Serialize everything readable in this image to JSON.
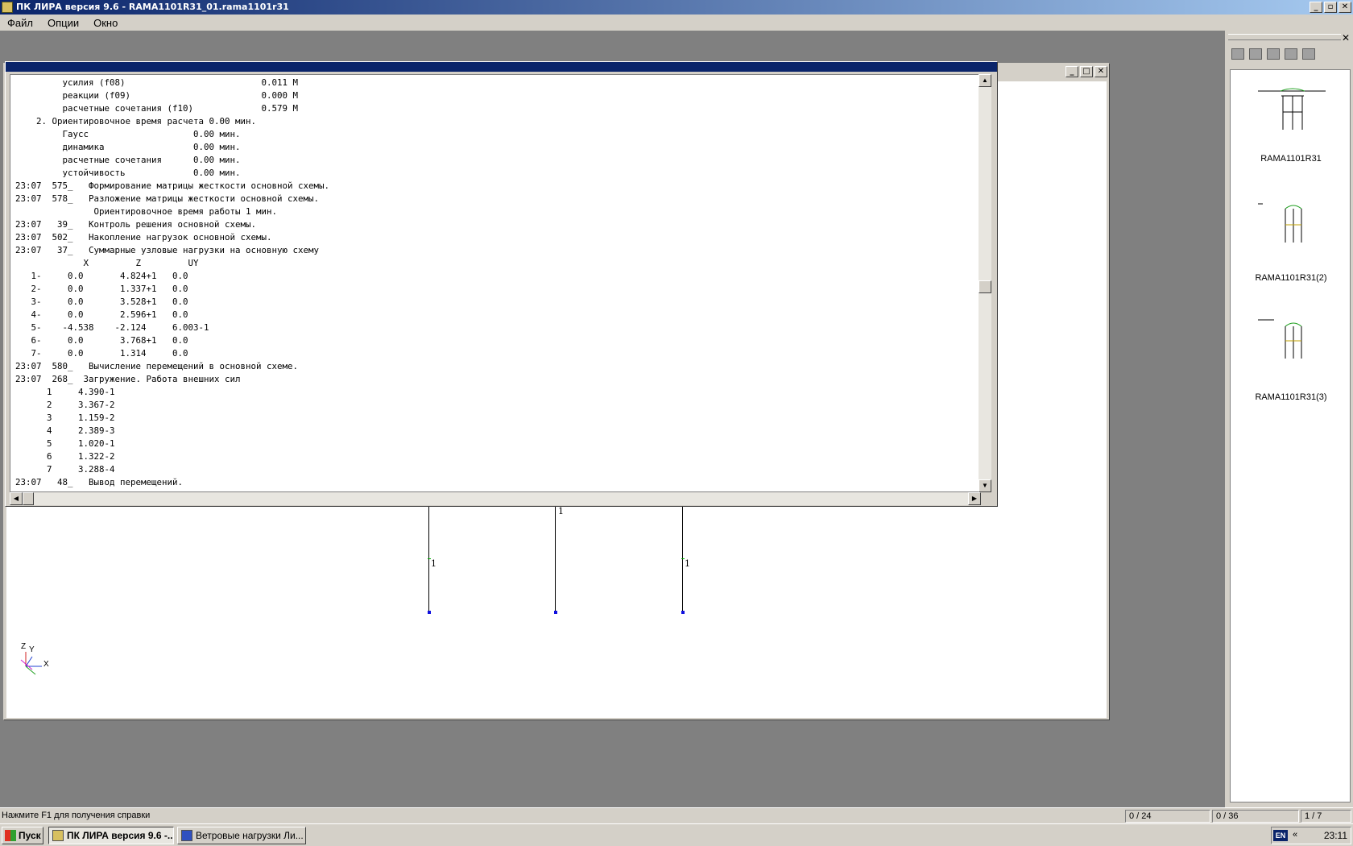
{
  "app": {
    "title": "ПК ЛИРА  версия 9.6 - RAMA1101R31_01.rama1101r31",
    "caption_buttons": [
      "_",
      "▫",
      "✕"
    ]
  },
  "menu": [
    "Файл",
    "Опции",
    "Окно"
  ],
  "schema": {
    "caption_buttons": [
      "_",
      "□",
      "✕"
    ],
    "column_labels": [
      "1",
      "1",
      "1",
      "1",
      "1"
    ],
    "axes": {
      "z": "Z",
      "y": "Y",
      "x": "X"
    }
  },
  "protocol": {
    "lines": [
      "         усилия (f08)                          0.011 M",
      "         реакции (f09)                         0.000 M",
      "         расчетные сочетания (f10)             0.579 M",
      "    2. Ориентировочное время расчета 0.00 мин.",
      "         Гаусс                    0.00 мин.",
      "         динамика                 0.00 мин.",
      "         расчетные сочетания      0.00 мин.",
      "         устойчивость             0.00 мин.",
      "23:07  575_   Формирование матрицы жесткости основной схемы.",
      "23:07  578_   Разложение матрицы жесткости основной схемы.",
      "               Ориентировочное время работы 1 мин.",
      "23:07   39_   Контроль решения основной схемы.",
      "23:07  502_   Накопление нагрузок основной схемы.",
      "23:07   37_   Суммарные узловые нагрузки на основную схему",
      "             X         Z         UY",
      "   1-     0.0       4.824+1   0.0",
      "   2-     0.0       1.337+1   0.0",
      "   3-     0.0       3.528+1   0.0",
      "   4-     0.0       2.596+1   0.0",
      "   5-    -4.538    -2.124     6.003-1",
      "   6-     0.0       3.768+1   0.0",
      "   7-     0.0       1.314     0.0",
      "23:07  580_   Вычисление перемещений в основной схеме.",
      "23:07  268_  Загружение. Работа внешних сил",
      "      1     4.390-1",
      "      2     3.367-2",
      "      3     1.159-2",
      "      4     2.389-3",
      "      5     1.020-1",
      "      6     1.322-2",
      "      7     3.288-4",
      "23:07   48_   Вывод перемещений."
    ]
  },
  "right_panel": {
    "close": "✕",
    "toolbar_icons": [
      "refresh-icon",
      "save-icon",
      "copy-icon",
      "grid-icon",
      "print-icon"
    ],
    "thumbnails": [
      {
        "label": "RAMA1101R31"
      },
      {
        "label": "RAMA1101R31(2)"
      },
      {
        "label": "RAMA1101R31(3)"
      }
    ]
  },
  "status": {
    "help": "Нажмите F1 для получения справки",
    "cells": [
      "0 / 24",
      "0 / 36",
      "1 / 7"
    ]
  },
  "taskbar": {
    "start": "Пуск",
    "tasks": [
      {
        "label": "ПК ЛИРА  версия 9.6 -...",
        "active": true
      },
      {
        "label": "Ветровые нагрузки Ли...",
        "active": false
      }
    ],
    "lang": "EN",
    "tray_arrows": "«",
    "clock": "23:11"
  }
}
